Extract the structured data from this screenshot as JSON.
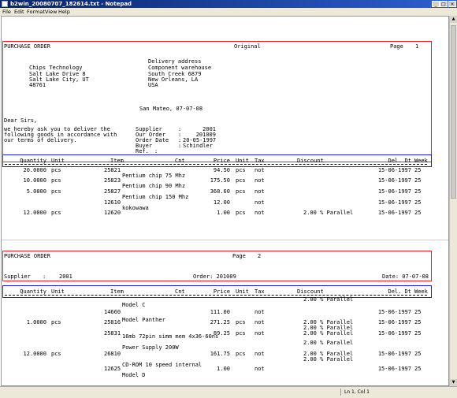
{
  "window": {
    "title": "b2win_20080707_182614.txt - Notepad",
    "minimize": "_",
    "maximize": "□",
    "close": "×"
  },
  "menu": [
    "File",
    "Edit",
    "Format",
    "View",
    "Help"
  ],
  "status": {
    "position": "Ln 1, Col 1"
  },
  "page1": {
    "header": {
      "doc": "PURCHASE ORDER",
      "copy": "Original",
      "page_label": "Page",
      "page_no": "1"
    },
    "sender": [
      "Chips Technology",
      "Salt Lake Drive 8",
      "Salt Lake City, UT",
      "48761"
    ],
    "delivery": [
      "Delivery address",
      "Component warehouse",
      "South Creek 6879",
      "New Orleans, LA",
      "USA"
    ],
    "place_date": "San Mateo, 07-07-08",
    "salutation": "Dear Sirs,",
    "intro": [
      "we hereby ask you to deliver the",
      "following goods in accordance with",
      "our terms of delivery."
    ],
    "fields": [
      {
        "label": "Supplier",
        "sep": ":",
        "value": "2001"
      },
      {
        "label": "Our Order",
        "sep": ":",
        "value": "201009"
      },
      {
        "label": "Order Date",
        "sep": ":",
        "value": "20-05-1997"
      },
      {
        "label": "Buyer",
        "sep": ":",
        "value": "Schindler"
      },
      {
        "label": "Ref.",
        "sep": ":",
        "value": ""
      }
    ],
    "columns": {
      "qty": "Quantity",
      "unit": "Unit",
      "item": "Item",
      "cnt": "Cnt",
      "price": "Price",
      "punit": "Unit",
      "tax": "Tax",
      "discount": "Discount",
      "del": "Del. Dt",
      "week": "Week"
    },
    "rows": [
      {
        "qty": "20.0000",
        "unit": "pcs",
        "item": "25821",
        "price": "94.50",
        "punit": "pcs",
        "tax": "not",
        "discount": "",
        "del": "15-06-1997",
        "week": "25",
        "desc": "Pentium chip 75 Mhz"
      },
      {
        "qty": "10.0000",
        "unit": "pcs",
        "item": "25823",
        "price": "175.50",
        "punit": "pcs",
        "tax": "not",
        "discount": "",
        "del": "15-06-1997",
        "week": "25",
        "desc": "Pentium chip 90 Mhz"
      },
      {
        "qty": "5.0000",
        "unit": "pcs",
        "item": "25827",
        "price": "368.60",
        "punit": "pcs",
        "tax": "not",
        "discount": "",
        "del": "15-06-1997",
        "week": "25",
        "desc": "Pentium chip 150 Mhz"
      },
      {
        "qty": "",
        "unit": "",
        "item": "12610",
        "price": "12.00",
        "punit": "",
        "tax": "not",
        "discount": "",
        "del": "15-06-1997",
        "week": "25",
        "desc": "kokowawa"
      },
      {
        "qty": "12.0000",
        "unit": "pcs",
        "item": "12620",
        "price": "1.00",
        "punit": "pcs",
        "tax": "not",
        "discount": "2.00 % Parallel",
        "del": "15-06-1997",
        "week": "25",
        "desc": ""
      }
    ]
  },
  "page2": {
    "header": {
      "doc": "PURCHASE ORDER",
      "page_label": "Page",
      "page_no": "2"
    },
    "supplier_line": {
      "label": "Supplier",
      "sep": ":",
      "value": "2001",
      "order": "Order: 201009",
      "date": "Date: 07-07-08"
    },
    "columns": {
      "qty": "Quantity",
      "unit": "Unit",
      "item": "Item",
      "cnt": "Cnt",
      "price": "Price",
      "punit": "Unit",
      "tax": "Tax",
      "discount": "Discount",
      "del": "Del. Dt",
      "week": "Week"
    },
    "overflow": "2.00 % Parallel",
    "lines": [
      {
        "kind": "desc",
        "text": "Model C"
      },
      {
        "kind": "row",
        "qty": "",
        "unit": "",
        "item": "14660",
        "price": "111.00",
        "punit": "",
        "tax": "not",
        "discount": "",
        "del": "15-06-1997",
        "week": "25"
      },
      {
        "kind": "desc",
        "text": "Model Panther"
      },
      {
        "kind": "row",
        "qty": "1.0000",
        "unit": "pcs",
        "item": "25816",
        "price": "271.25",
        "punit": "pcs",
        "tax": "not",
        "discount": "2.00 % Parallel",
        "del": "15-06-1997",
        "week": "25"
      },
      {
        "kind": "disc",
        "text": "2.00 % Parallel"
      },
      {
        "kind": "row",
        "qty": "",
        "unit": "",
        "item": "25831",
        "price": "89.25",
        "punit": "pcs",
        "tax": "not",
        "discount": "2.00 % Parallel",
        "del": "15-06-1997",
        "week": "25"
      },
      {
        "kind": "desc",
        "text": "16mb 72pin simm mem 4x36-60ns"
      },
      {
        "kind": "disc",
        "text": "2.00 % Parallel"
      },
      {
        "kind": "desc",
        "text": "Power Supply 200W"
      },
      {
        "kind": "row",
        "qty": "12.0000",
        "unit": "pcs",
        "item": "26810",
        "price": "161.75",
        "punit": "pcs",
        "tax": "not",
        "discount": "2.00 % Parallel",
        "del": "15-06-1997",
        "week": "25"
      },
      {
        "kind": "disc",
        "text": "2.00 % Parallel"
      },
      {
        "kind": "desc",
        "text": "CD-ROM 10 speed internal"
      },
      {
        "kind": "row",
        "qty": "",
        "unit": "",
        "item": "12625",
        "price": "1.00",
        "punit": "",
        "tax": "not",
        "discount": "",
        "del": "15-06-1997",
        "week": "25"
      },
      {
        "kind": "desc",
        "text": "Model D"
      }
    ]
  }
}
